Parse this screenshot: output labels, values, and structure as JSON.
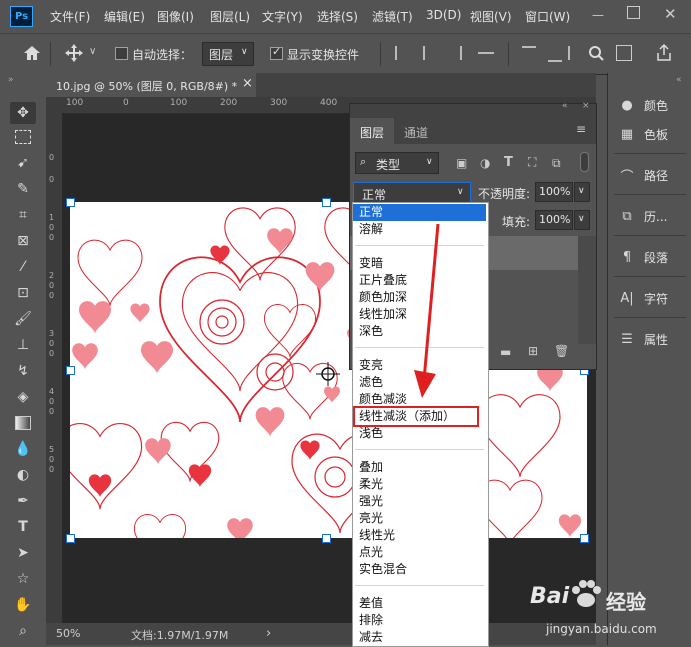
{
  "app": {
    "logo": "Ps"
  },
  "menu": [
    "文件(F)",
    "编辑(E)",
    "图像(I)",
    "图层(L)",
    "文字(Y)",
    "选择(S)",
    "滤镜(T)",
    "3D(D)",
    "视图(V)",
    "窗口(W)"
  ],
  "options": {
    "auto_select_label": "自动选择：",
    "auto_select_value": "图层",
    "show_transform_label": "显示变换控件"
  },
  "document": {
    "tab_title": "10.jpg @ 50% (图层 0, RGB/8#) *",
    "close_glyph": "×",
    "ruler_top": [
      "100",
      "0",
      "100",
      "200",
      "300",
      "400"
    ],
    "ruler_left": [
      "0",
      "0",
      "1",
      "0",
      "0",
      "2",
      "0",
      "0",
      "3",
      "0",
      "0",
      "4",
      "0",
      "0",
      "5",
      "0",
      "0",
      "6",
      "0",
      "0",
      "7"
    ]
  },
  "status": {
    "zoom": "50%",
    "doc_info": "文档:1.97M/1.97M",
    "arrow": "›"
  },
  "layers_panel": {
    "tabs": [
      "图层",
      "通道"
    ],
    "filter_kind": "类型",
    "blend_mode": "正常",
    "opacity_label": "不透明度:",
    "opacity_value": "100%",
    "fill_label": "填充:",
    "fill_value": "100%"
  },
  "blend_dropdown": {
    "groups": [
      [
        "正常",
        "溶解"
      ],
      [
        "变暗",
        "正片叠底",
        "颜色加深",
        "线性加深",
        "深色"
      ],
      [
        "变亮",
        "滤色",
        "颜色减淡",
        "线性减淡（添加）",
        "浅色"
      ],
      [
        "叠加",
        "柔光",
        "强光",
        "亮光",
        "线性光",
        "点光",
        "实色混合"
      ],
      [
        "差值",
        "排除",
        "减去"
      ]
    ],
    "selected": "正常",
    "highlighted": "线性减淡（添加）"
  },
  "right_panels": [
    "颜色",
    "色板",
    "路径",
    "历...",
    "段落",
    "字符",
    "属性"
  ],
  "watermark": {
    "brand": "Bai",
    "brand_cn": "经验",
    "url": "jingyan.baidu.com"
  },
  "colors": {
    "accent_blue": "#1e6fd8",
    "annotation_red": "#e02020",
    "panel_bg": "#535353",
    "canvas_bg": "#282828"
  }
}
